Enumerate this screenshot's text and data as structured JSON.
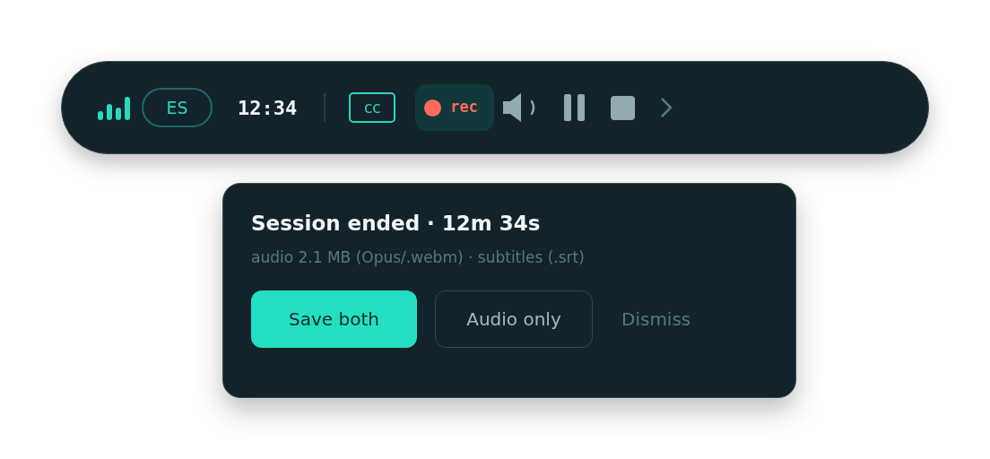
{
  "toolbar": {
    "language": "ES",
    "time": "12:34",
    "captions": "cc",
    "record": {
      "label": "rec",
      "recording": true
    }
  },
  "dialog": {
    "title": "Session ended · 12m 34s",
    "subtitle": "audio 2.1 MB (Opus/.webm) · subtitles (.srt)",
    "actions": [
      {
        "label": "Save both",
        "kind": "primary"
      },
      {
        "label": "Audio only",
        "kind": "outline"
      },
      {
        "label": "Dismiss",
        "kind": "link"
      }
    ]
  }
}
